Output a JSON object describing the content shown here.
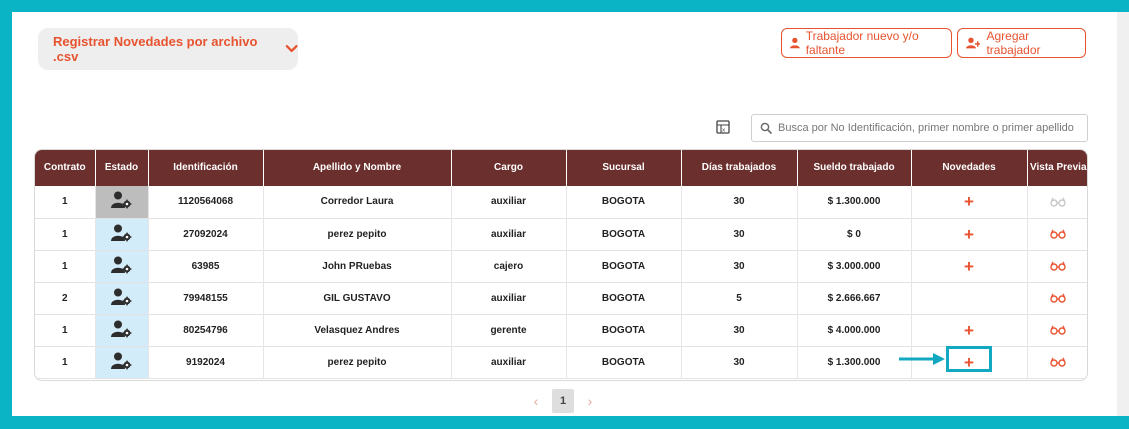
{
  "toolbar": {
    "csv_label": "Registrar Novedades por archivo .csv",
    "new_worker_label": "Trabajador nuevo y/o faltante",
    "add_worker_label": "Agregar trabajador"
  },
  "search": {
    "placeholder": "Busca por No Identificación, primer nombre o primer apellido"
  },
  "table": {
    "headers": [
      "Contrato",
      "Estado",
      "Identificación",
      "Apellido y Nombre",
      "Cargo",
      "Sucursal",
      "Días trabajados",
      "Sueldo trabajado",
      "Novedades",
      "Vista Previa"
    ],
    "rows": [
      {
        "contrato": "1",
        "estado": "inactive",
        "id": "1120564068",
        "nombre": "Corredor Laura",
        "cargo": "auxiliar",
        "sucursal": "BOGOTA",
        "dias": "30",
        "sueldo": "$ 1.300.000",
        "novedad": true
      },
      {
        "contrato": "1",
        "estado": "active",
        "id": "27092024",
        "nombre": "perez pepito",
        "cargo": "auxiliar",
        "sucursal": "BOGOTA",
        "dias": "30",
        "sueldo": "$ 0",
        "novedad": true
      },
      {
        "contrato": "1",
        "estado": "active",
        "id": "63985",
        "nombre": "John PRuebas",
        "cargo": "cajero",
        "sucursal": "BOGOTA",
        "dias": "30",
        "sueldo": "$ 3.000.000",
        "novedad": true
      },
      {
        "contrato": "2",
        "estado": "active",
        "id": "79948155",
        "nombre": "GIL GUSTAVO",
        "cargo": "auxiliar",
        "sucursal": "BOGOTA",
        "dias": "5",
        "sueldo": "$ 2.666.667",
        "novedad": false
      },
      {
        "contrato": "1",
        "estado": "active",
        "id": "80254796",
        "nombre": "Velasquez Andres",
        "cargo": "gerente",
        "sucursal": "BOGOTA",
        "dias": "30",
        "sueldo": "$ 4.000.000",
        "novedad": true
      },
      {
        "contrato": "1",
        "estado": "active",
        "id": "9192024",
        "nombre": "perez pepito",
        "cargo": "auxiliar",
        "sucursal": "BOGOTA",
        "dias": "30",
        "sueldo": "$ 1.300.000",
        "novedad": true
      }
    ],
    "plus_symbol": "+"
  },
  "pagination": {
    "prev": "‹",
    "current": "1",
    "next": "›"
  },
  "colors": {
    "accent": "#e8532f",
    "header_bg": "#6b2f2d",
    "frame": "#0ab4c4",
    "highlight": "#13a8c2"
  },
  "icons": [
    "chevron-down-icon",
    "user-icon",
    "user-plus-icon",
    "excel-icon",
    "search-icon",
    "user-gear-icon",
    "plus-icon",
    "glasses-icon",
    "arrow-right-icon"
  ]
}
